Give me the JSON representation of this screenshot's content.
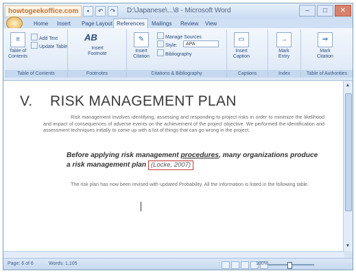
{
  "window": {
    "title": "D:\\Japanese\\...\\8 - Microsoft Word",
    "watermark": "howtogeekoffice.com"
  },
  "quick_access": [
    "save",
    "undo",
    "redo"
  ],
  "tabs": [
    {
      "label": "Home"
    },
    {
      "label": "Insert"
    },
    {
      "label": "Page Layout"
    },
    {
      "label": "References",
      "active": true
    },
    {
      "label": "Mailings"
    },
    {
      "label": "Review"
    },
    {
      "label": "View"
    }
  ],
  "ribbon": {
    "toc": {
      "button": "Table of Contents",
      "add_text": "Add Text",
      "update_table": "Update Table",
      "group": "Table of Contents"
    },
    "footnotes": {
      "insert": "Insert Footnote",
      "ab_label": "AB",
      "group": "Footnotes"
    },
    "citations": {
      "insert": "Insert Citation",
      "manage": "Manage Sources",
      "style_label": "Style:",
      "style_value": "APA",
      "bibliography": "Bibliography",
      "group": "Citations & Bibliography"
    },
    "captions": {
      "insert": "Insert Caption",
      "group": "Captions"
    },
    "index": {
      "mark": "Mark Entry",
      "group": "Index"
    },
    "authorities": {
      "mark": "Mark Citation",
      "group": "Table of Authorities"
    }
  },
  "document": {
    "heading_number": "V.",
    "heading_text": "RISK MANAGEMENT PLAN",
    "para1": "Risk management involves identifying, assessing and responding to project risks in order to minimize the likelihood and impact of consequences of adverse events on the achievement of the project objective. We performed the identification and assessment techniques initially to come up with a list of things that can go wrong in the project.",
    "quote_part1": "Before applying risk management ",
    "quote_underlined": "procedures",
    "quote_part2": ", many organizations produce a risk management plan",
    "citation": "(Locke, 2007)",
    "para2": "The risk plan has now been revised with updated Probability. All the information is listed in the following table."
  },
  "status": {
    "page": "Page: 6 of 6",
    "words": "Words: 1,105",
    "zoom": "100%"
  },
  "colors": {
    "accent": "#2c4c7c",
    "citation_border": "#c0392b"
  }
}
